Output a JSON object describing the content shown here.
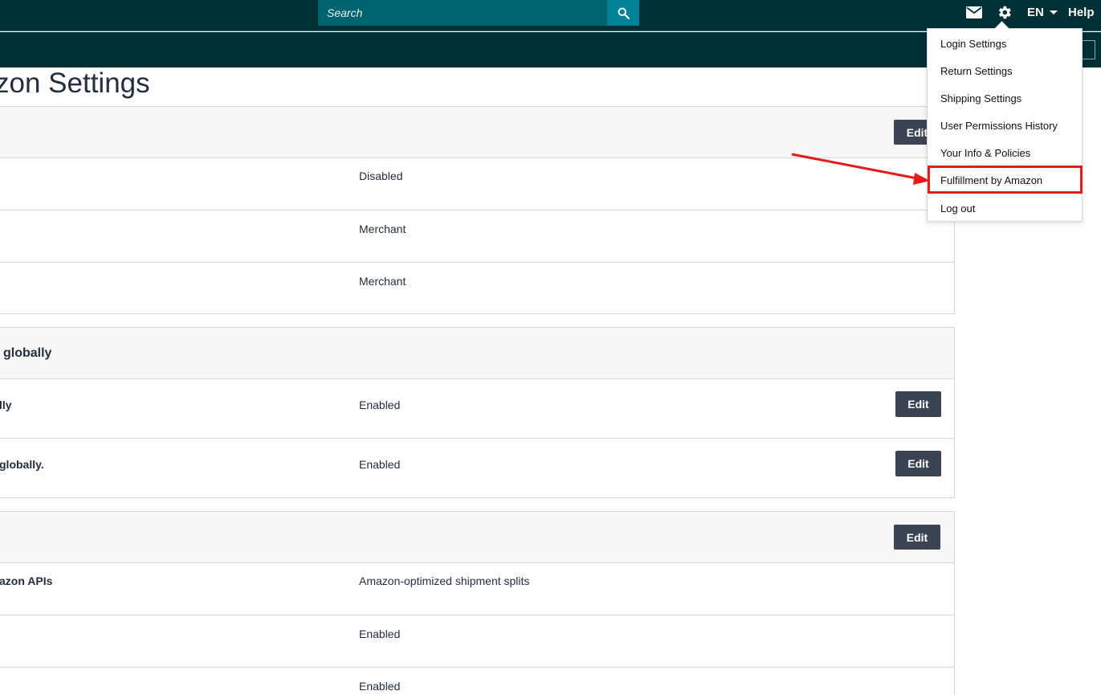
{
  "search": {
    "placeholder": "Search"
  },
  "header": {
    "language": "EN",
    "help_label": "Help"
  },
  "page": {
    "title": "zon Settings"
  },
  "sections": [
    {
      "header_title": "",
      "edit_label": "Edit",
      "rows": [
        {
          "label": "",
          "value": "Disabled"
        },
        {
          "label": "",
          "value": "Merchant"
        },
        {
          "label": "",
          "value": "Merchant"
        }
      ]
    },
    {
      "header_title": "globally",
      "rows": [
        {
          "label": "lly",
          "value": "Enabled",
          "edit_label": "Edit"
        },
        {
          "label": "globally.",
          "value": "Enabled",
          "edit_label": "Edit"
        }
      ]
    },
    {
      "header_title": "",
      "edit_label": "Edit",
      "rows": [
        {
          "label": "azon APIs",
          "value": "Amazon-optimized shipment splits"
        },
        {
          "label": "",
          "value": "Enabled"
        },
        {
          "label": "",
          "value": "Enabled"
        }
      ]
    }
  ],
  "menu": {
    "items": [
      "Login Settings",
      "Return Settings",
      "Shipping Settings",
      "User Permissions History",
      "Your Info & Policies",
      "Fulfillment by Amazon",
      "Log out"
    ]
  },
  "colors": {
    "nav": "#002f36",
    "search_bg": "#00646e",
    "search_btn": "#008296",
    "button": "#3a4453",
    "highlight": "#e21b1b"
  }
}
